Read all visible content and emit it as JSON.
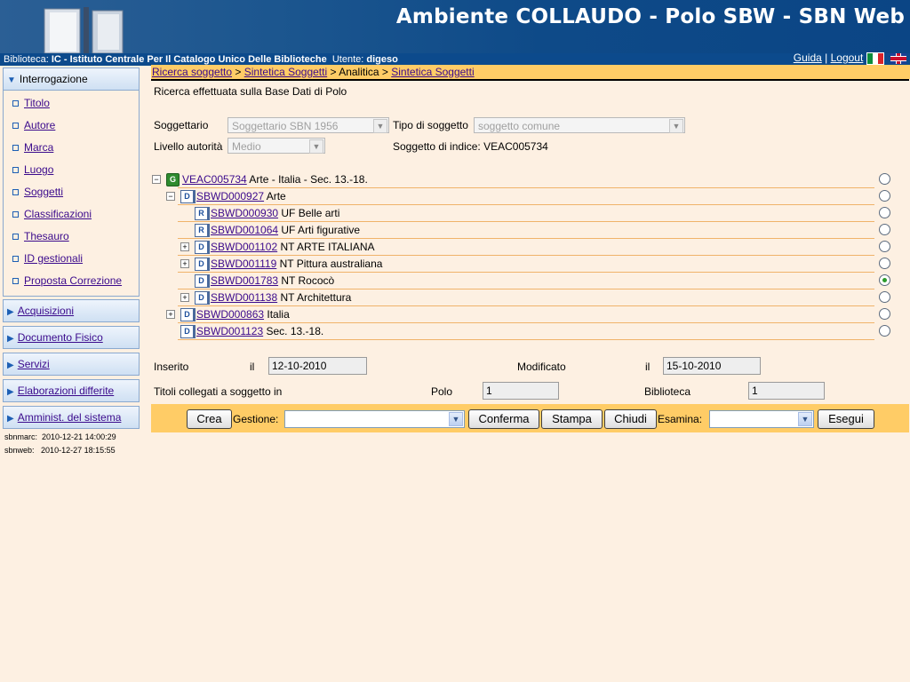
{
  "header": {
    "app_title": "Ambiente COLLAUDO - Polo SBW - SBN Web",
    "biblioteca_label": "Biblioteca:",
    "biblioteca_value": "IC - Istituto Centrale Per Il Catalogo Unico Delle Biblioteche",
    "utente_label": "Utente:",
    "utente_value": "digeso",
    "guida": "Guida",
    "logout": "Logout",
    "separator": "|"
  },
  "sidebar": {
    "sections": [
      {
        "label": "Interrogazione",
        "open": true
      },
      {
        "label": "Acquisizioni"
      },
      {
        "label": "Documento Fisico"
      },
      {
        "label": "Servizi"
      },
      {
        "label": "Elaborazioni differite"
      },
      {
        "label": "Amminist. del sistema"
      }
    ],
    "items": [
      "Titolo",
      "Autore",
      "Marca",
      "Luogo",
      "Soggetti",
      "Classificazioni",
      "Thesauro",
      "ID gestionali",
      "Proposta Correzione"
    ],
    "footer": [
      {
        "label": "sbnmarc:",
        "value": "2010-12-21 14:00:29"
      },
      {
        "label": "sbnweb:",
        "value": "2010-12-27 18:15:55"
      }
    ]
  },
  "breadcrumb": {
    "items": [
      "Ricerca soggetto",
      "Sintetica Soggetti",
      "Analitica",
      "Sintetica Soggetti"
    ],
    "sep": ">"
  },
  "main": {
    "subtitle": "Ricerca effettuata sulla Base Dati di Polo",
    "soggettario_label": "Soggettario",
    "soggettario_value": "Soggettario SBN 1956",
    "tipo_label": "Tipo di soggetto",
    "tipo_value": "soggetto comune",
    "livello_label": "Livello autorità",
    "livello_value": "Medio",
    "indice_label": "Soggetto di indice:",
    "indice_value": "VEAC005734"
  },
  "tree": [
    {
      "id": "VEAC005734",
      "text": "Arte - Italia - Sec. 13.-18.",
      "icon": "G",
      "toggle": "−",
      "selected": false
    },
    {
      "id": "SBWD000927",
      "text": "Arte",
      "icon": "D",
      "toggle": "−",
      "selected": false
    },
    {
      "id": "SBWD000930",
      "text": "UF Belle arti",
      "icon": "R",
      "toggle": "",
      "selected": false
    },
    {
      "id": "SBWD001064",
      "text": "UF Arti figurative",
      "icon": "R",
      "toggle": "",
      "selected": false
    },
    {
      "id": "SBWD001102",
      "text": "NT ARTE ITALIANA",
      "icon": "D",
      "toggle": "+",
      "selected": false
    },
    {
      "id": "SBWD001119",
      "text": "NT Pittura australiana",
      "icon": "D",
      "toggle": "+",
      "selected": false
    },
    {
      "id": "SBWD001783",
      "text": "NT Rococò",
      "icon": "D",
      "toggle": "",
      "selected": true
    },
    {
      "id": "SBWD001138",
      "text": "NT Architettura",
      "icon": "D",
      "toggle": "+",
      "selected": false
    },
    {
      "id": "SBWD000863",
      "text": "Italia",
      "icon": "D",
      "toggle": "+",
      "selected": false
    },
    {
      "id": "SBWD001123",
      "text": "Sec. 13.-18.",
      "icon": "D",
      "toggle": "",
      "selected": false
    }
  ],
  "details": {
    "inserito_label": "Inserito",
    "il_label": "il",
    "inserito_value": "12-10-2010",
    "modificato_label": "Modificato",
    "modificato_value": "15-10-2010",
    "titoli_label": "Titoli collegati a soggetto in",
    "polo_label": "Polo",
    "polo_value": "1",
    "biblioteca_label": "Biblioteca",
    "biblioteca_value": "1"
  },
  "actions": {
    "crea": "Crea",
    "gestione_label": "Gestione:",
    "gestione_value": "",
    "conferma": "Conferma",
    "stampa": "Stampa",
    "chiudi": "Chiudi",
    "esamina_label": "Esamina:",
    "esamina_value": "",
    "esegui": "Esegui"
  }
}
